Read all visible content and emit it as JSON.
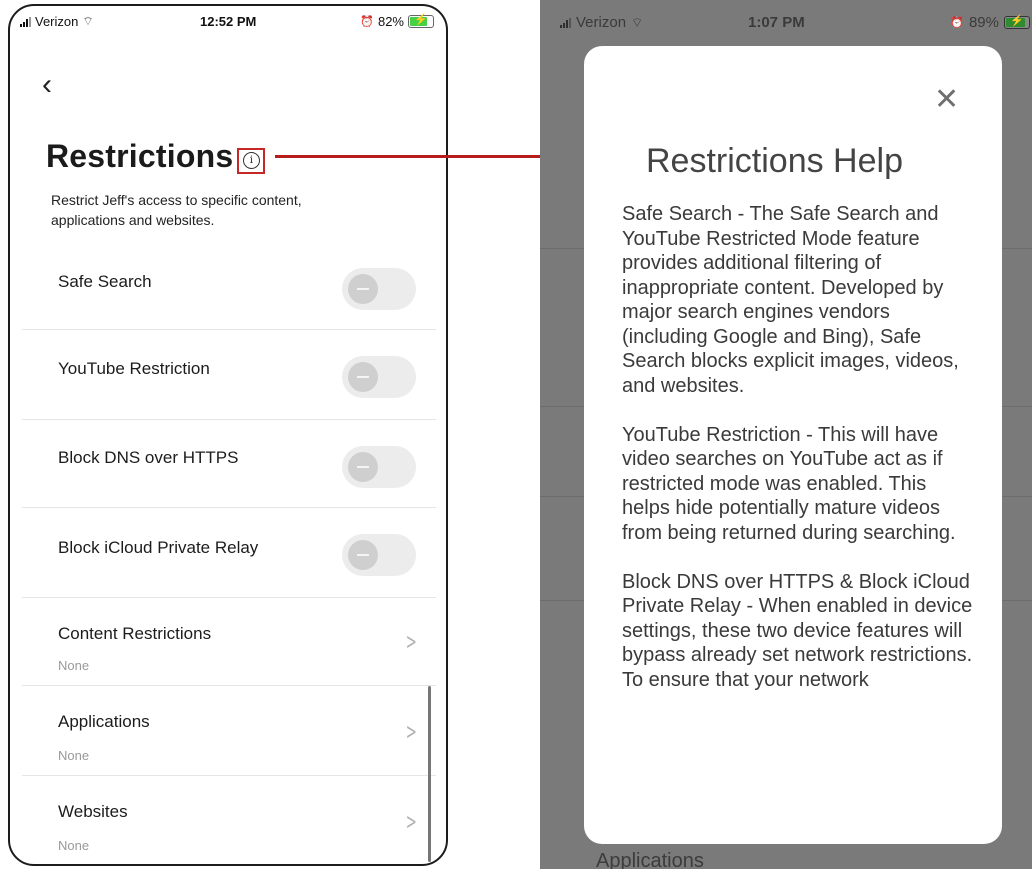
{
  "left_screen": {
    "status": {
      "carrier": "Verizon",
      "time": "12:52 PM",
      "battery": "82%",
      "battery_level": 0.82
    },
    "title": "Restrictions",
    "subtitle": "Restrict Jeff's access to specific content, applications and websites.",
    "toggles": [
      {
        "label": "Safe Search",
        "on": false
      },
      {
        "label": "YouTube Restriction",
        "on": false
      },
      {
        "label": "Block DNS over HTTPS",
        "on": false
      },
      {
        "label": "Block iCloud Private Relay",
        "on": false
      }
    ],
    "links": [
      {
        "label": "Content Restrictions",
        "value": "None"
      },
      {
        "label": "Applications",
        "value": "None"
      },
      {
        "label": "Websites",
        "value": "None"
      }
    ]
  },
  "right_screen": {
    "status": {
      "carrier": "Verizon",
      "time": "1:07 PM",
      "battery": "89%",
      "battery_level": 0.89
    },
    "background_partial_label": "Applications",
    "modal": {
      "title": "Restrictions Help",
      "paragraphs": [
        "Safe Search - The Safe Search and YouTube Restricted Mode feature provides additional filtering of inappropriate content. Developed by major search engines vendors (including Google and Bing), Safe Search blocks explicit images, videos, and websites.",
        "YouTube Restriction - This will have video searches on YouTube act as if restricted mode was enabled. This helps hide potentially mature videos from being returned during searching.",
        "Block DNS over HTTPS & Block iCloud Private Relay - When enabled in device settings, these two device features will bypass already set network restrictions. To ensure that your network"
      ]
    }
  },
  "colors": {
    "annotation": "#b71c1c",
    "toggle_off": "#ececec",
    "knob": "#cfcfcf"
  }
}
